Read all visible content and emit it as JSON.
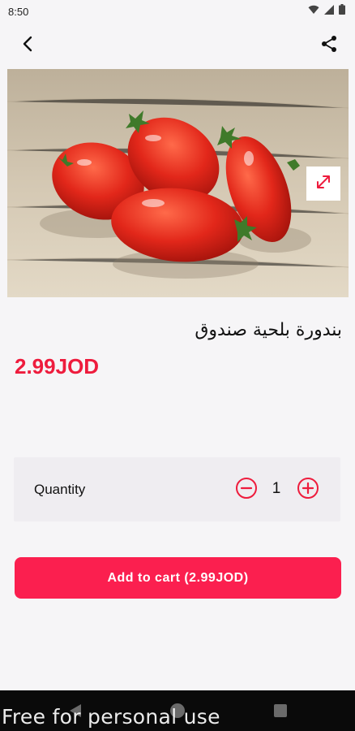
{
  "status_bar": {
    "time": "8:50",
    "icons": [
      "wifi-icon",
      "signal-icon",
      "battery-icon"
    ]
  },
  "app_bar": {
    "back_icon": "chevron-left-icon",
    "share_icon": "share-icon"
  },
  "product": {
    "image_subject": "tomatoes",
    "expand_icon": "expand-icon",
    "name": "بندورة بلحية صندوق",
    "price": "2.99JOD"
  },
  "quantity": {
    "label": "Quantity",
    "value": "1",
    "minus_icon": "minus-circle-icon",
    "plus_icon": "plus-circle-icon"
  },
  "cart": {
    "button_label": "Add to cart (2.99JOD)"
  },
  "nav_bar": {
    "icons": [
      "nav-back-icon",
      "nav-home-icon",
      "nav-recent-icon"
    ]
  },
  "watermark": "Free for personal use",
  "colors": {
    "accent": "#ee1c3d",
    "button": "#fb1f4f",
    "background": "#f6f5f7",
    "quantity_bg": "#efedf1"
  }
}
